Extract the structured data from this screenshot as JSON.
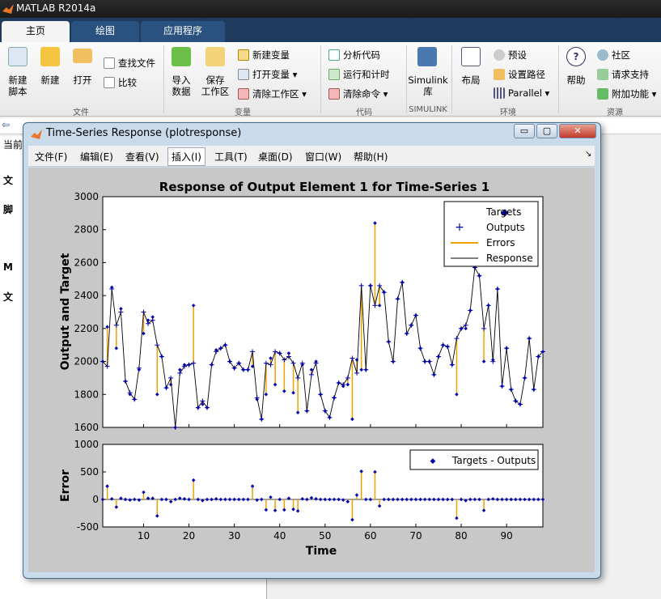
{
  "app": {
    "title": "MATLAB R2014a"
  },
  "tabs": [
    {
      "label": "主页"
    },
    {
      "label": "绘图"
    },
    {
      "label": "应用程序"
    }
  ],
  "ribbon": {
    "file": {
      "new_script": "新建\n脚本",
      "new": "新建",
      "open": "打开",
      "find_files": "查找文件",
      "compare": "比较",
      "group": "文件"
    },
    "variable": {
      "import": "导入\n数据",
      "save": "保存\n工作区",
      "new_var": "新建变量",
      "open_var": "打开变量",
      "clear_ws": "清除工作区",
      "group": "变量"
    },
    "code": {
      "analyze": "分析代码",
      "run_time": "运行和计时",
      "clear_cmd": "清除命令",
      "group": "代码"
    },
    "simulink": {
      "lib": "Simulink\n库",
      "group": "SIMULINK"
    },
    "env": {
      "layout": "布局",
      "prefs": "预设",
      "set_path": "设置路径",
      "parallel": "Parallel",
      "group": "环境"
    },
    "resources": {
      "help": "帮助",
      "community": "社区",
      "request": "请求支持",
      "addons": "附加功能",
      "group": "资源"
    }
  },
  "left": {
    "current": "当前",
    "items": [
      "文",
      "脚",
      "M",
      "文"
    ]
  },
  "figure": {
    "title": "Time-Series Response (plotresponse)",
    "menu": [
      "文件(F)",
      "编辑(E)",
      "查看(V)",
      "插入(I)",
      "工具(T)",
      "桌面(D)",
      "窗口(W)",
      "帮助(H)"
    ],
    "buttons": {
      "min": "▭",
      "max": "▢",
      "close": "✕"
    }
  },
  "chart_data": [
    {
      "type": "line",
      "title": "Response of Output Element 1 for Time-Series 1",
      "ylabel": "Output and Target",
      "xlim": [
        1,
        98
      ],
      "ylim": [
        1600,
        3000
      ],
      "yticks": [
        1600,
        1800,
        2000,
        2200,
        2400,
        2600,
        2800,
        3000
      ],
      "legend": [
        "Targets",
        "Outputs",
        "Errors",
        "Response"
      ],
      "legend_position": "top-right",
      "colors": {
        "targets": "#0000aa",
        "outputs": "#0000aa",
        "errors": "#f0a000",
        "response": "#000000"
      },
      "targets": [
        2000,
        2210,
        2450,
        2080,
        2320,
        1880,
        1800,
        1770,
        1950,
        2170,
        2250,
        2270,
        1800,
        2030,
        1840,
        1860,
        1600,
        1950,
        1980,
        1980,
        2340,
        1720,
        1740,
        1720,
        1980,
        2070,
        2080,
        2100,
        2000,
        1960,
        1990,
        1950,
        1950,
        1970,
        1770,
        1650,
        1800,
        2020,
        1860,
        2050,
        1820,
        2050,
        1810,
        1690,
        1980,
        1700,
        1950,
        2000,
        1800,
        1700,
        1660,
        1780,
        1870,
        1850,
        1860,
        1650,
        2010,
        1950,
        1950,
        2460,
        2840,
        2340,
        2420,
        2120,
        2000,
        2380,
        2480,
        2170,
        2220,
        2280,
        2080,
        2000,
        2000,
        1920,
        2030,
        2100,
        2090,
        1980,
        1800,
        2200,
        2200,
        2310,
        2570,
        2520,
        2000,
        2340,
        2010,
        2440,
        1850,
        2080,
        1830,
        1760,
        1740,
        1900,
        2140,
        1830,
        2030,
        2060
      ],
      "outputs": [
        2000,
        1970,
        2440,
        2220,
        2300,
        1880,
        1810,
        1770,
        1960,
        2300,
        2230,
        2250,
        2100,
        2030,
        1840,
        1900,
        1600,
        1930,
        1970,
        1980,
        1990,
        1720,
        1760,
        1720,
        1980,
        2060,
        2080,
        2100,
        2000,
        1960,
        1990,
        1950,
        1950,
        2060,
        1780,
        1650,
        1990,
        1980,
        2060,
        2050,
        2010,
        2030,
        1990,
        1900,
        1990,
        1700,
        1920,
        1990,
        1800,
        1700,
        1660,
        1780,
        1870,
        1860,
        1900,
        2020,
        1930,
        2460,
        1950,
        2460,
        2340,
        2460,
        2420,
        2120,
        2000,
        2380,
        2480,
        2170,
        2220,
        2280,
        2080,
        2000,
        2000,
        1920,
        2030,
        2100,
        2090,
        1980,
        2140,
        2200,
        2220,
        2310,
        2570,
        2520,
        2200,
        2340,
        2000,
        2440,
        1850,
        2080,
        1830,
        1760,
        1740,
        1900,
        2140,
        1830,
        2030,
        2060
      ]
    },
    {
      "type": "line",
      "ylabel": "Error",
      "xlabel": "Time",
      "xlim": [
        1,
        98
      ],
      "ylim": [
        -500,
        1000
      ],
      "yticks": [
        -500,
        0,
        500,
        1000
      ],
      "xticks": [
        10,
        20,
        30,
        40,
        50,
        60,
        70,
        80,
        90
      ],
      "legend": [
        "Targets - Outputs"
      ],
      "legend_position": "top-right",
      "errors": [
        0,
        240,
        10,
        -140,
        20,
        0,
        -10,
        0,
        -10,
        130,
        20,
        20,
        -300,
        0,
        0,
        -40,
        0,
        20,
        10,
        0,
        350,
        0,
        -20,
        0,
        0,
        10,
        0,
        0,
        0,
        0,
        0,
        0,
        0,
        240,
        -10,
        0,
        -190,
        40,
        -200,
        0,
        -190,
        20,
        -180,
        -210,
        10,
        0,
        30,
        10,
        0,
        0,
        0,
        0,
        0,
        -10,
        -40,
        -370,
        80,
        510,
        0,
        0,
        500,
        -120,
        0,
        0,
        0,
        0,
        0,
        0,
        0,
        0,
        0,
        0,
        0,
        0,
        0,
        0,
        0,
        0,
        -340,
        0,
        -20,
        0,
        0,
        0,
        -200,
        0,
        10,
        0,
        0,
        0,
        0,
        0,
        0,
        0,
        0,
        0,
        0,
        0
      ]
    }
  ]
}
